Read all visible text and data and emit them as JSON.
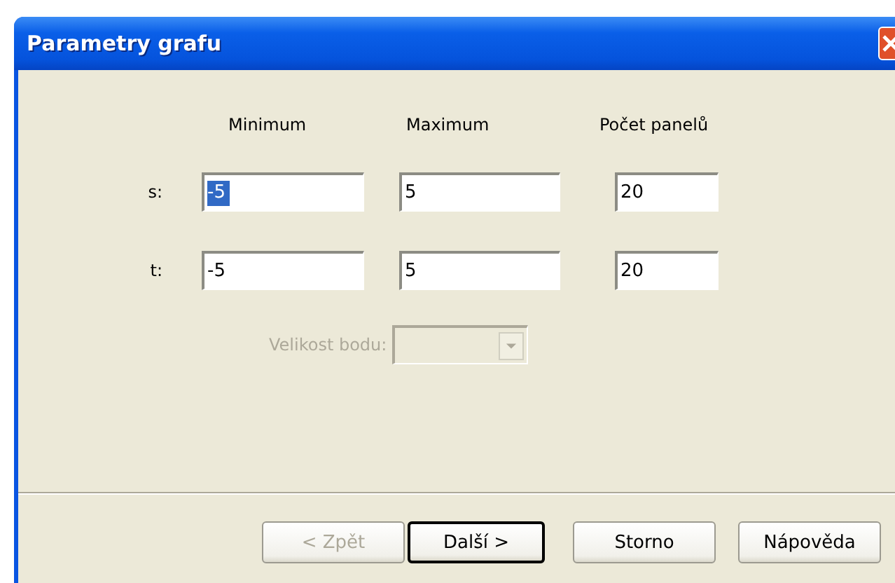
{
  "window": {
    "title": "Parametry grafu"
  },
  "columns": [
    "Minimum",
    "Maximum",
    "Počet panelů"
  ],
  "rows": [
    {
      "label": "s:",
      "fields": [
        {
          "value": "-5",
          "selected": true
        },
        {
          "value": "5",
          "selected": false
        },
        {
          "value": "20",
          "selected": false
        }
      ]
    },
    {
      "label": "t:",
      "fields": [
        {
          "value": "-5",
          "selected": false
        },
        {
          "value": "5",
          "selected": false
        },
        {
          "value": "20",
          "selected": false
        }
      ]
    }
  ],
  "point_size": {
    "label": "Velikost bodu:",
    "disabled": true
  },
  "buttons": [
    {
      "label": "< Zpět",
      "disabled": true,
      "default": false
    },
    {
      "label": "Další >",
      "disabled": false,
      "default": true
    },
    {
      "label": "Storno",
      "disabled": false,
      "default": false
    },
    {
      "label": "Nápověda",
      "disabled": false,
      "default": false
    }
  ]
}
